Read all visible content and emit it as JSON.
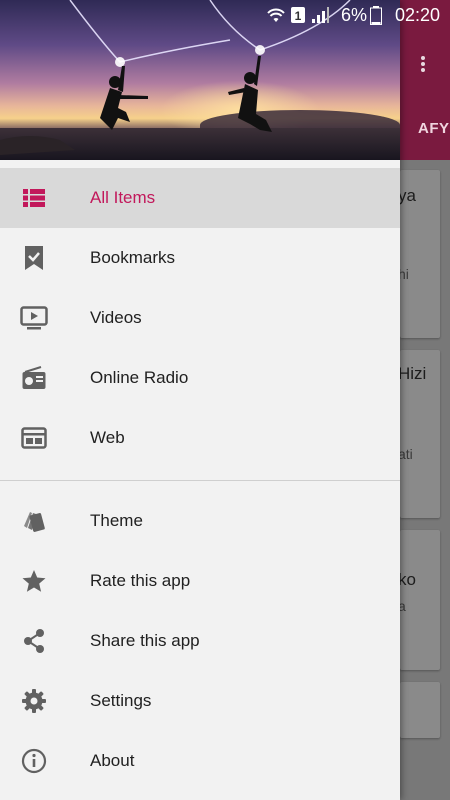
{
  "status_bar": {
    "battery_percent": "6%",
    "time": "02:20",
    "sim_label": "1"
  },
  "background": {
    "tab_partial": "AFY",
    "cards": [
      {
        "title": "ya",
        "snippet": "hi"
      },
      {
        "title": "Hizi",
        "snippet": "ati"
      },
      {
        "title": "ko",
        "snippet": "a"
      }
    ]
  },
  "drawer": {
    "items_top": [
      {
        "label": "All Items",
        "icon": "list-icon",
        "active": true
      },
      {
        "label": "Bookmarks",
        "icon": "bookmark-check-icon"
      },
      {
        "label": "Videos",
        "icon": "video-play-icon"
      },
      {
        "label": "Online Radio",
        "icon": "radio-icon"
      },
      {
        "label": "Web",
        "icon": "web-icon"
      }
    ],
    "items_bottom": [
      {
        "label": "Theme",
        "icon": "theme-icon"
      },
      {
        "label": "Rate this app",
        "icon": "star-icon"
      },
      {
        "label": "Share this app",
        "icon": "share-icon"
      },
      {
        "label": "Settings",
        "icon": "gear-icon"
      },
      {
        "label": "About",
        "icon": "info-icon"
      }
    ]
  },
  "colors": {
    "accent": "#c2185b",
    "icon": "#616161",
    "appbar": "#7a1a3f"
  }
}
